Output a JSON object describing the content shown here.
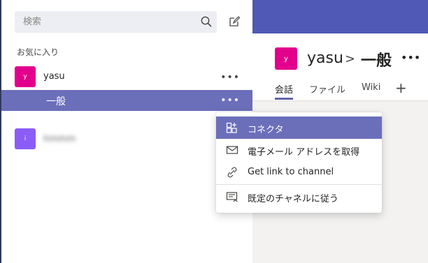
{
  "search": {
    "placeholder": "検索"
  },
  "sidebar": {
    "section_label": "お気に入り",
    "teams": [
      {
        "name": "yasu",
        "avatar_letter": "y",
        "avatar_color": "#e3008c",
        "more": "•••"
      },
      {
        "name": "hmmm",
        "avatar_letter": "i",
        "avatar_color": "#8b5cf6"
      }
    ],
    "selected_channel": {
      "name": "一般",
      "more": "•••"
    }
  },
  "header": {
    "avatar_letter": "y",
    "team": "yasu",
    "separator": ">",
    "channel": "一般",
    "more": "•••"
  },
  "tabs": [
    {
      "label": "会話",
      "active": true
    },
    {
      "label": "ファイル",
      "active": false
    },
    {
      "label": "Wiki",
      "active": false
    }
  ],
  "tab_add": "+",
  "context_menu": {
    "items": [
      {
        "label": "コネクタ",
        "icon": "connector-icon",
        "active": true
      },
      {
        "label": "電子メール アドレスを取得",
        "icon": "mail-icon",
        "active": false
      },
      {
        "label": "Get link to channel",
        "icon": "link-icon",
        "active": false
      },
      {
        "label": "既定のチャネルに従う",
        "icon": "follow-channel-icon",
        "active": false
      }
    ]
  },
  "colors": {
    "brand": "#5059b5",
    "selection": "#6b6fba",
    "team_avatar": "#e3008c"
  }
}
